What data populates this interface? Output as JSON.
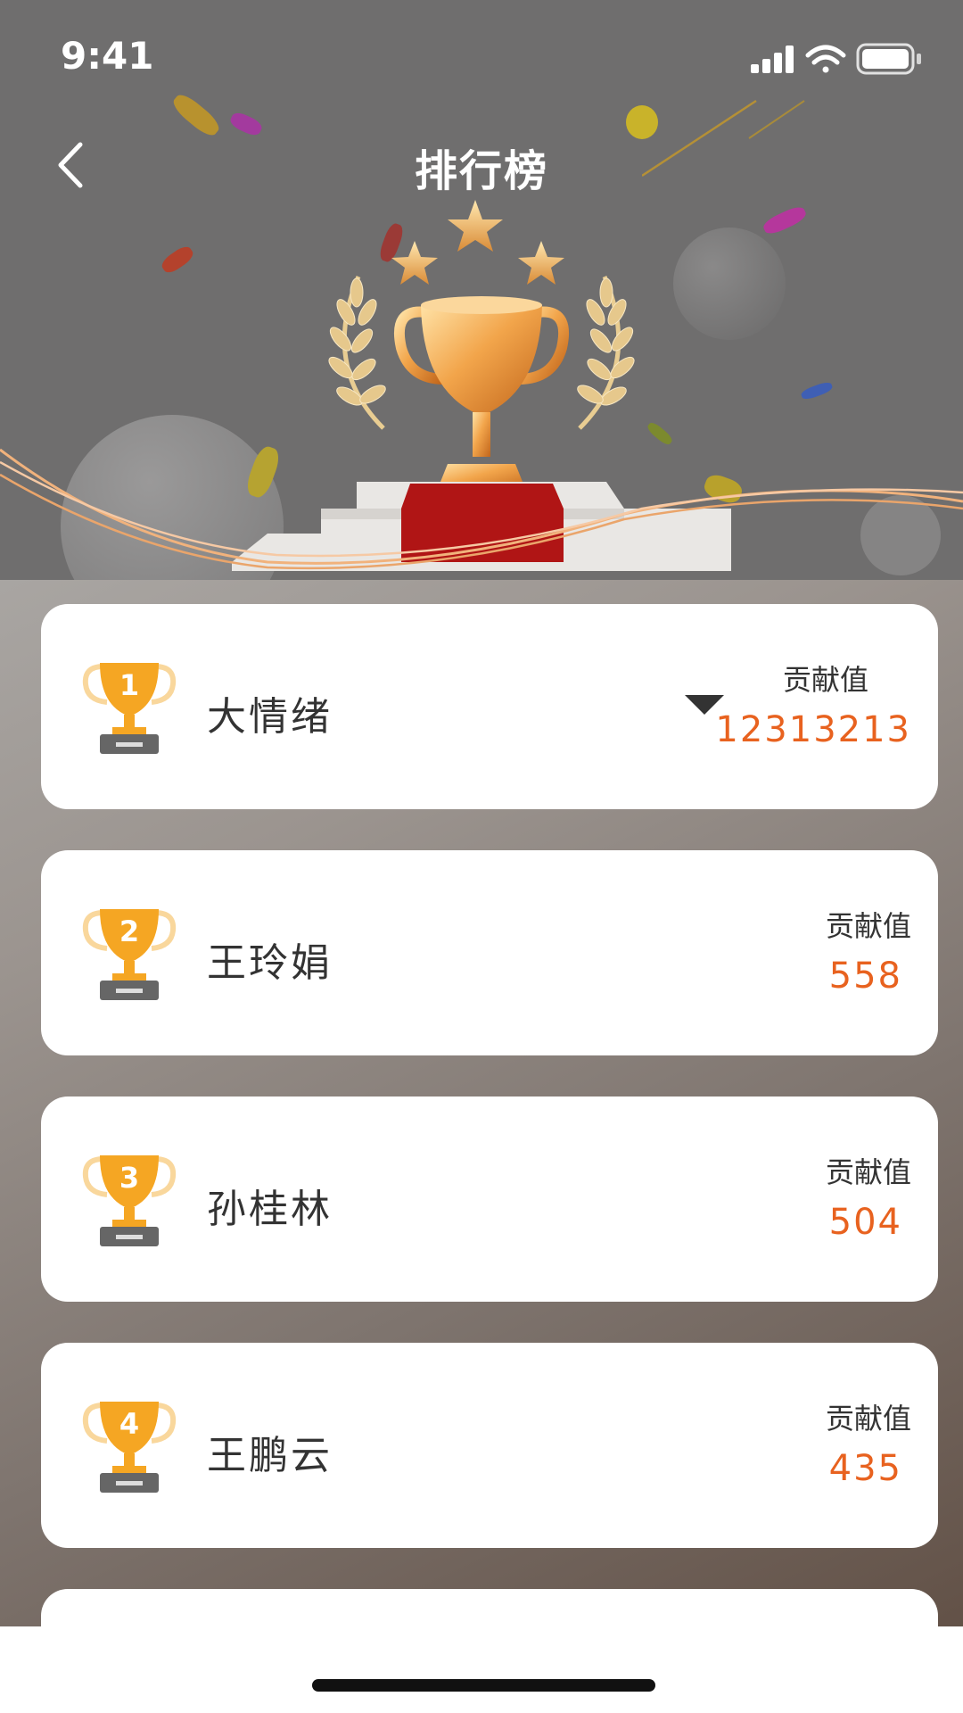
{
  "status_bar": {
    "time": "9:41"
  },
  "header": {
    "title": "排行榜"
  },
  "ranking": {
    "score_label": "贡献值",
    "items": [
      {
        "rank": "1",
        "name": "大情绪",
        "score": "12313213"
      },
      {
        "rank": "2",
        "name": "王玲娟",
        "score": "558"
      },
      {
        "rank": "3",
        "name": "孙桂林",
        "score": "504"
      },
      {
        "rank": "4",
        "name": "王鹏云",
        "score": "435"
      }
    ]
  },
  "colors": {
    "accent": "#e8621f",
    "trophy": "#f5a623",
    "header_bg": "#6f6e6e"
  },
  "icons": {
    "back": "chevron-left-icon",
    "signal": "cellular-signal-icon",
    "wifi": "wifi-icon",
    "battery": "battery-icon",
    "dropdown": "caret-down-icon",
    "rank": "trophy-icon"
  }
}
